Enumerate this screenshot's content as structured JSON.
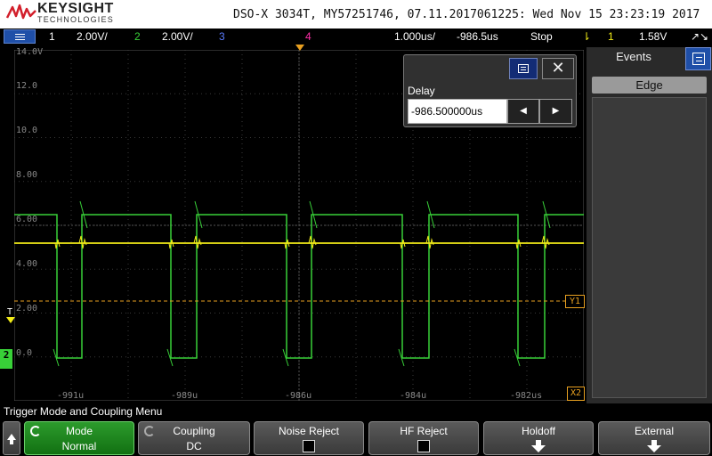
{
  "titlebar": {
    "logo_word": "KEYSIGHT",
    "logo_sub": "TECHNOLOGIES",
    "title": "DSO-X 3034T, MY57251746, 07.11.2017061225: Wed Nov 15 23:23:19 2017"
  },
  "status": {
    "ch1_num": "1",
    "ch1_scale": "2.00V/",
    "ch2_num": "2",
    "ch2_scale": "2.00V/",
    "ch3_num": "3",
    "ch4_num": "4",
    "timebase": "1.000us/",
    "delay": "-986.5us",
    "run_state": "Stop",
    "trig_ch": "1",
    "trig_level": "1.58V"
  },
  "graticule": {
    "y_labels": [
      "14.0V",
      "12.0",
      "10.0",
      "8.00",
      "6.00",
      "4.00",
      "2.00",
      "0.0"
    ],
    "x_labels": [
      "-991u",
      "-989u",
      "-986u",
      "-984u",
      "-982us"
    ],
    "marker_y1": "Y1",
    "marker_x2": "X2",
    "marker_t": "T",
    "marker_ch2": "2"
  },
  "delay_dialog": {
    "label": "Delay",
    "value": "-986.500000us",
    "close_glyph": "✕",
    "left_glyph": "◀",
    "right_glyph": "▶"
  },
  "events": {
    "title": "Events",
    "edge_label": "Edge"
  },
  "menu": {
    "title": "Trigger Mode and Coupling Menu",
    "softkeys": [
      {
        "title": "Mode",
        "value": "Normal"
      },
      {
        "title": "Coupling",
        "value": "DC"
      },
      {
        "title": "Noise Reject"
      },
      {
        "title": "HF Reject"
      },
      {
        "title": "Holdoff"
      },
      {
        "title": "External"
      }
    ]
  },
  "colors": {
    "ch1": "#f2ec18",
    "ch2": "#38d038",
    "ch4": "#ff2ea8",
    "cursor": "#e8a020",
    "grid": "#3a3a3a"
  }
}
